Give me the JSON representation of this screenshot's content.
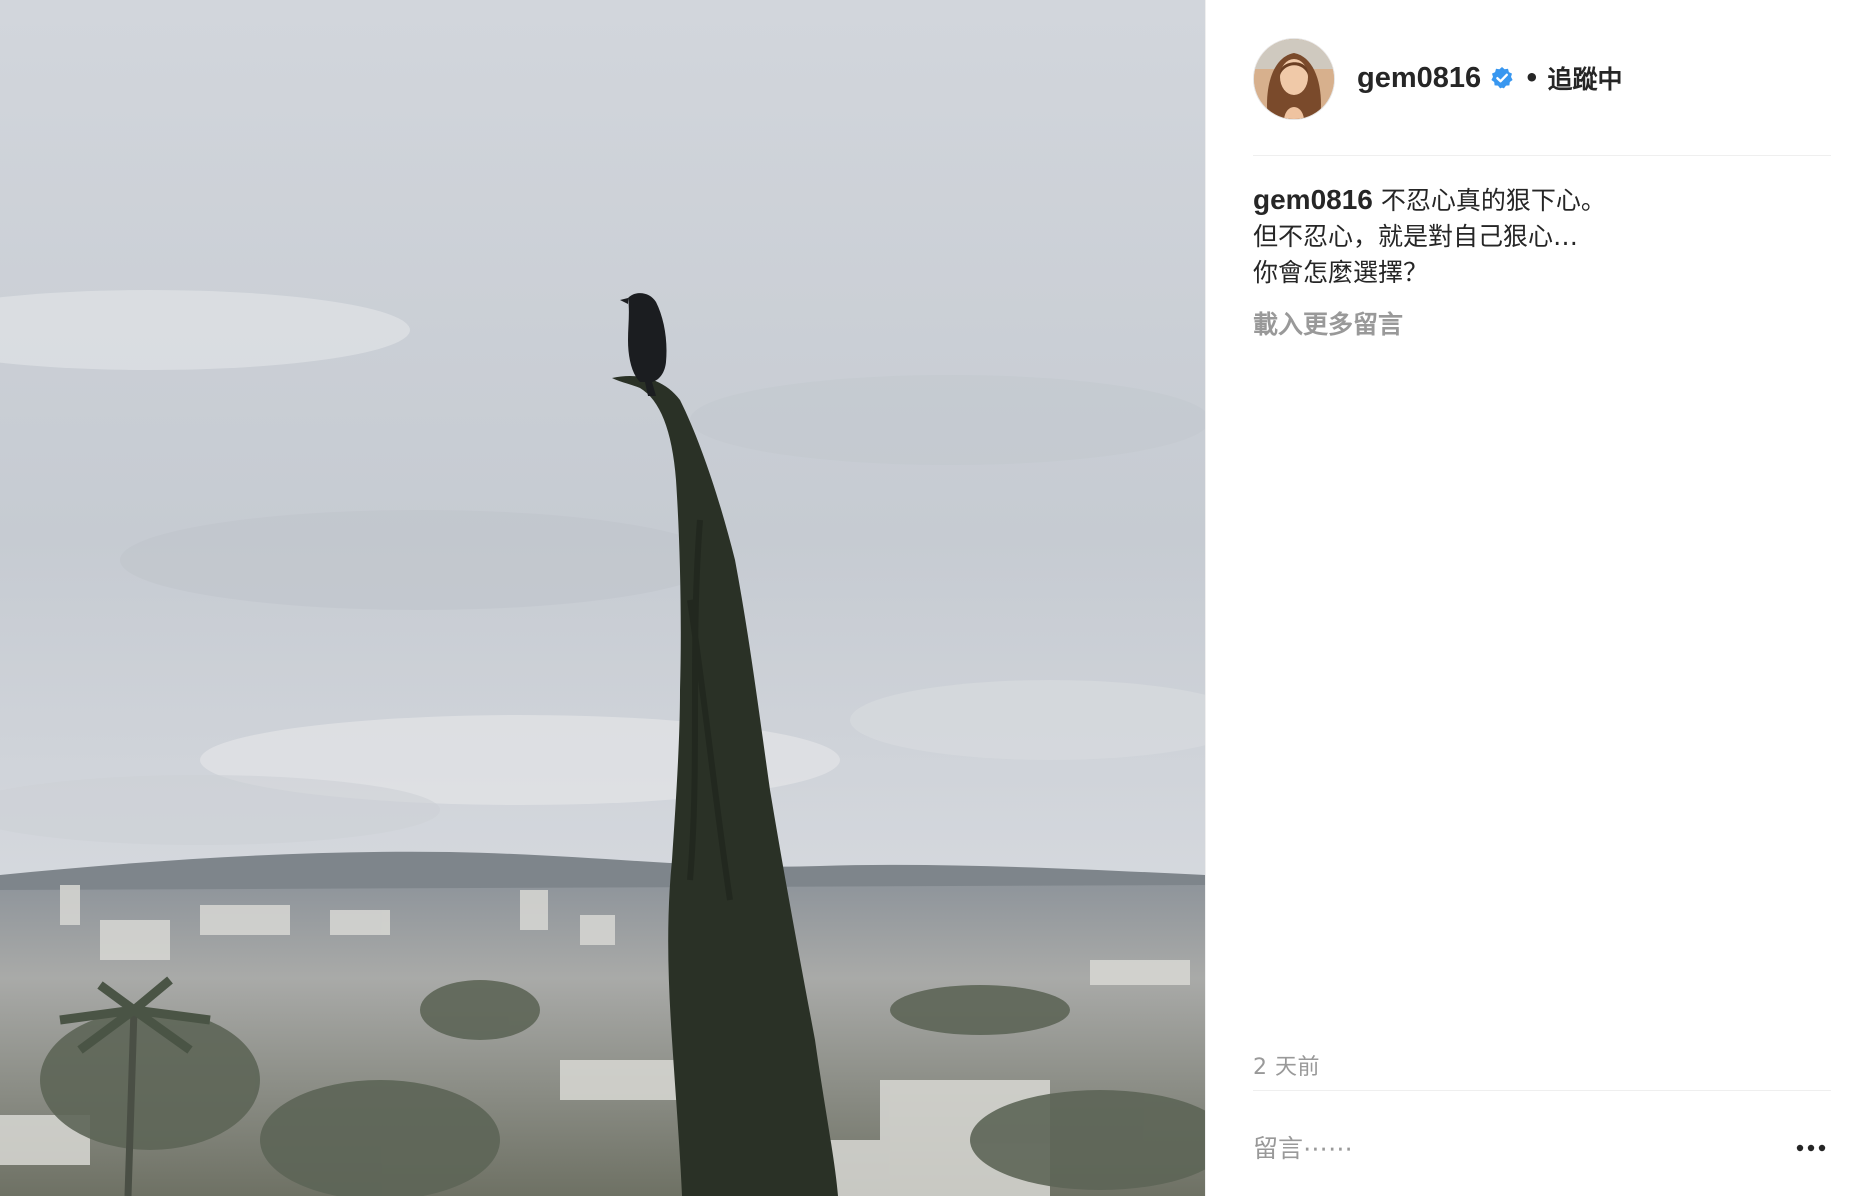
{
  "post": {
    "author": {
      "username": "gem0816",
      "verified_icon": "verified-badge-icon",
      "separator": "•",
      "follow_state": "追蹤中"
    },
    "caption": {
      "username": "gem0816",
      "lines": [
        "不忍心真的狠下心。",
        "但不忍心，就是對自己狠心…",
        "你會怎麼選擇？"
      ]
    },
    "load_more_label": "載入更多留言",
    "timestamp": "2 天前",
    "comment": {
      "placeholder": "留言⋯⋯",
      "value": ""
    },
    "more_icon": "more-options-icon",
    "photo_description_icon": "post-photo"
  },
  "colors": {
    "text_primary": "#262626",
    "text_secondary": "#999999",
    "divider": "#efefef",
    "verified_blue": "#3897f0"
  }
}
